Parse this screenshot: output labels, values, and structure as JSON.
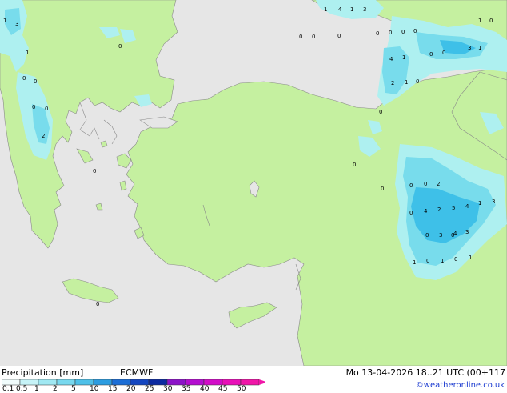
{
  "map": {
    "region": "Eastern Mediterranean / Turkey",
    "colors": {
      "sea": "#e6e6e6",
      "land": "#c5f0a0",
      "land_outline": "#8a8a8a",
      "precip_light": "#aef0f0",
      "precip_mid": "#78dcec",
      "precip_heavy": "#3ec0e8"
    },
    "precip_labels": [
      {
        "text": "1"
      },
      {
        "text": "4"
      },
      {
        "text": "1"
      },
      {
        "text": "3"
      },
      {
        "text": "1"
      },
      {
        "text": "3"
      },
      {
        "text": "1"
      },
      {
        "text": "0"
      },
      {
        "text": "0"
      },
      {
        "text": "0"
      },
      {
        "text": "0"
      },
      {
        "text": "0"
      },
      {
        "text": "0"
      },
      {
        "text": "0"
      },
      {
        "text": "0"
      },
      {
        "text": "0"
      },
      {
        "text": "0"
      },
      {
        "text": "1"
      },
      {
        "text": "3"
      },
      {
        "text": "0"
      },
      {
        "text": "1"
      },
      {
        "text": "4"
      },
      {
        "text": "1"
      },
      {
        "text": "2"
      },
      {
        "text": "1"
      },
      {
        "text": "0"
      },
      {
        "text": "0"
      },
      {
        "text": "0"
      },
      {
        "text": "0"
      },
      {
        "text": "0"
      },
      {
        "text": "0"
      },
      {
        "text": "2"
      },
      {
        "text": "0"
      },
      {
        "text": "0"
      },
      {
        "text": "0"
      },
      {
        "text": "0"
      },
      {
        "text": "2"
      },
      {
        "text": "0"
      },
      {
        "text": "0"
      },
      {
        "text": "4"
      },
      {
        "text": "2"
      },
      {
        "text": "5"
      },
      {
        "text": "4"
      },
      {
        "text": "1"
      },
      {
        "text": "3"
      },
      {
        "text": "0"
      },
      {
        "text": "3"
      },
      {
        "text": "4"
      },
      {
        "text": "3"
      },
      {
        "text": "1"
      },
      {
        "text": "0"
      },
      {
        "text": "1"
      },
      {
        "text": "0"
      },
      {
        "text": "1"
      },
      {
        "text": "0"
      },
      {
        "text": "0"
      }
    ]
  },
  "legend": {
    "title": "Precipitation [mm]",
    "model": "ECMWF",
    "ticks": [
      "0.1",
      "0.5",
      "1",
      "2",
      "5",
      "10",
      "15",
      "20",
      "25",
      "30",
      "35",
      "40",
      "45",
      "50"
    ],
    "scale_colors": [
      "#f0fcfc",
      "#c6f3f7",
      "#a0e8f2",
      "#78d8ee",
      "#4ec0e8",
      "#2c9ce0",
      "#1c6ed6",
      "#1446c0",
      "#0c2aa0",
      "#8c14c8",
      "#b40ed0",
      "#d20cc8",
      "#e810b8",
      "#f016a8"
    ]
  },
  "valid_time": "Mo 13-04-2026 18..21 UTC (00+117",
  "credit": "©weatheronline.co.uk"
}
